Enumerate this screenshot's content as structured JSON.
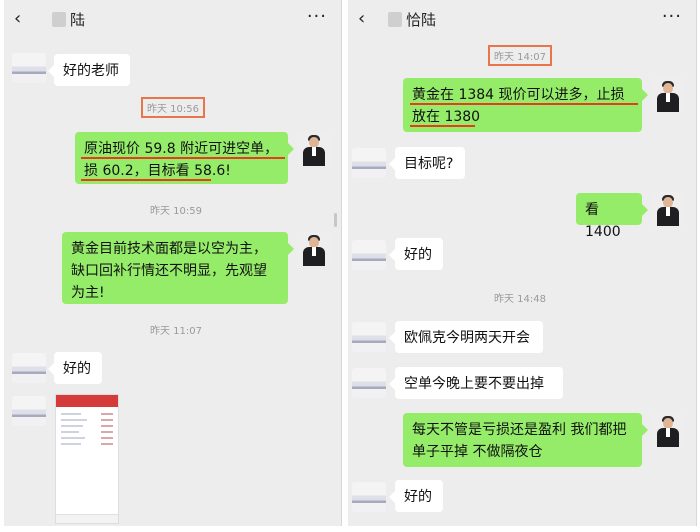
{
  "left": {
    "header": {
      "back": "‹",
      "title": "陆",
      "more": "···"
    },
    "timestamps": [
      "昨天 10:56",
      "昨天 10:59",
      "昨天 11:07"
    ],
    "messages": {
      "m1": "好的老师",
      "m2": "原油现价 59.8 附近可进空单，损 60.2，目标看 58.6!",
      "m3": "黄金目前技术面都是以空为主，缺口回补行情还不明显，先观望为主!",
      "m4": "好的"
    }
  },
  "right": {
    "header": {
      "back": "‹",
      "title": "恰陆",
      "more": "···"
    },
    "timestamps": [
      "昨天 14:07",
      "昨天 14:48"
    ],
    "messages": {
      "m1": "黄金在 1384 现价可以进多，止损放在 1380",
      "m2": "目标呢?",
      "m3": "看 1400",
      "m4": "好的",
      "m5": "欧佩克今明两天开会",
      "m6": "空单今晚上要不要出掉",
      "m7": "每天不管是亏损还是盈利  我们都把单子平掉  不做隔夜仓",
      "m8": "好的"
    }
  },
  "colors": {
    "outgoing_bubble": "#95ec69",
    "incoming_bubble": "#ffffff",
    "highlight": "#e9764a",
    "underline": "#e83c20"
  }
}
